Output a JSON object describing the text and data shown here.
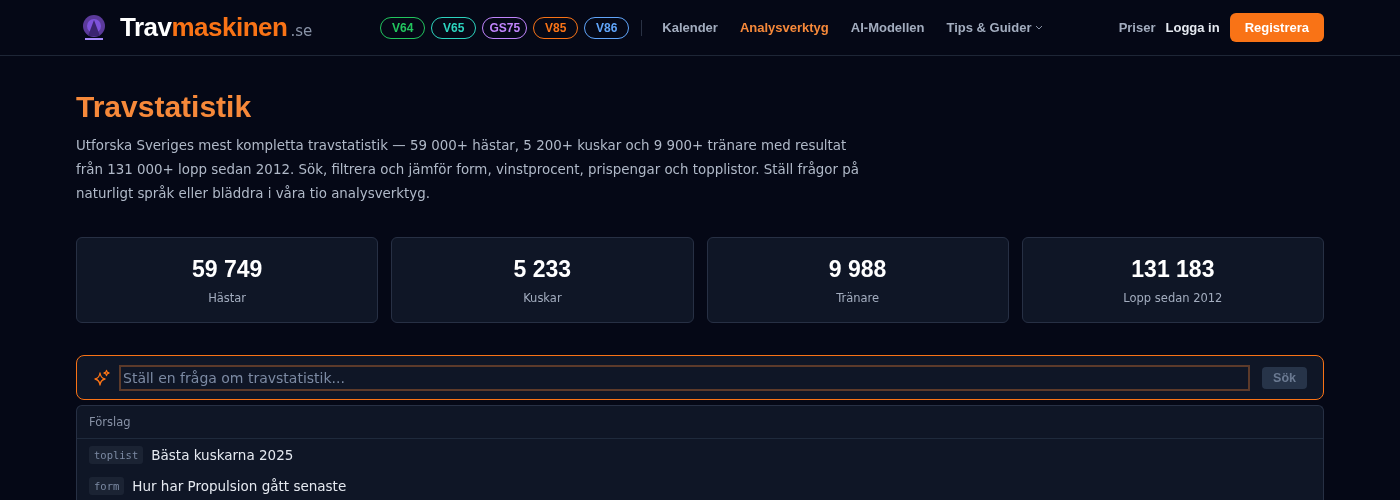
{
  "header": {
    "brand": {
      "name": "Trav",
      "accent": "maskinen",
      "suffix": ".se"
    },
    "games": [
      {
        "label": "V64",
        "color": "#22c55e"
      },
      {
        "label": "V65",
        "color": "#2dd4bf"
      },
      {
        "label": "GS75",
        "color": "#c084fc"
      },
      {
        "label": "V85",
        "color": "#f97316"
      },
      {
        "label": "V86",
        "color": "#60a5fa"
      }
    ],
    "nav": [
      {
        "label": "Kalender",
        "selected": false
      },
      {
        "label": "Analysverktyg",
        "selected": true
      },
      {
        "label": "AI-Modellen",
        "selected": false
      },
      {
        "label": "Tips & Guider",
        "selected": false,
        "kind": "dropdown"
      }
    ],
    "links": [
      "Priser",
      "Logga in"
    ],
    "register_button": "Registrera"
  },
  "title": "Travstatistik",
  "intro": "Utforska Sveriges mest kompletta travstatistik — 59 000+ hästar, 5 200+ kuskar och 9 900+ tränare med resultat från 131 000+ lopp sedan 2012. Sök, filtrera och jämför form, vinstprocent, prispengar och topplistor. Ställ frågor på naturligt språk eller bläddra i våra tio analysverktyg.",
  "stats": [
    {
      "value": "59 749",
      "label": "Hästar"
    },
    {
      "value": "5 233",
      "label": "Kuskar"
    },
    {
      "value": "9 988",
      "label": "Tränare"
    },
    {
      "value": "131 183",
      "label": "Lopp sedan 2012"
    }
  ],
  "search": {
    "placeholder": "Ställ en fråga om travstatistik...",
    "button": "Sök",
    "disabled": true
  },
  "suggestions": {
    "heading": "Förslag",
    "items": [
      {
        "tag": "toplist",
        "text": "Bästa kuskarna 2025"
      },
      {
        "tag": "form",
        "text": "Hur har Propulsion gått senaste"
      }
    ]
  }
}
